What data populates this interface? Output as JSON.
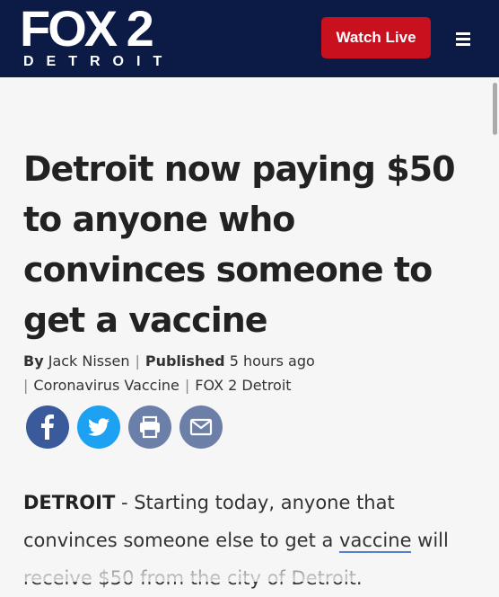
{
  "header": {
    "logo_main": "FOX 2",
    "logo_sub": "DETROIT",
    "watch_live_label": "Watch Live",
    "menu_icon": "hamburger-menu-icon",
    "background_color": "#0c1b46",
    "button_color": "#c8101e"
  },
  "article": {
    "headline": "Detroit now paying $50 to anyone who convinces someone to get a vaccine",
    "byline": {
      "by_label": "By",
      "author": "Jack Nissen",
      "published_label": "Published",
      "published_time": "5 hours ago",
      "tag_1": "Coronavirus Vaccine",
      "tag_2": "FOX 2 Detroit",
      "separator": "|"
    },
    "share_icons": [
      "facebook-icon",
      "twitter-icon",
      "print-icon",
      "email-icon"
    ],
    "body": {
      "dateline": "DETROIT",
      "dash": " - ",
      "text_1": "Starting today, anyone that convinces someone else to get a ",
      "link_text": "vaccine",
      "text_2": " will receive $50 from the city of Detroit."
    }
  }
}
